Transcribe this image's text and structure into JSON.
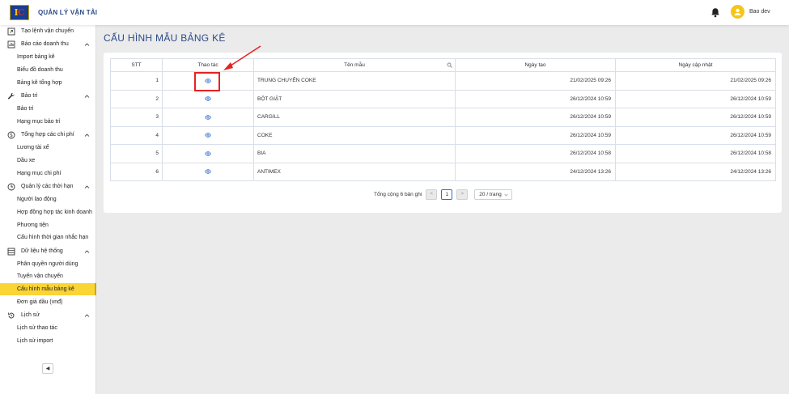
{
  "header": {
    "app_title": "QUẢN LÝ VẬN TẢI",
    "logo_text_left": "I",
    "logo_text_right": "C",
    "user_name": "Bao dev",
    "icons": {
      "notifications": "bell-icon",
      "avatar": "user-icon"
    }
  },
  "sidebar": {
    "groups": [
      {
        "label": "Tạo lệnh vận chuyển",
        "icon": "external-link-icon",
        "has_chevron": false
      },
      {
        "label": "Báo cáo doanh thu",
        "icon": "chart-icon",
        "items": [
          "Import bảng kê",
          "Biểu đồ doanh thu",
          "Bảng kê tổng hợp"
        ]
      },
      {
        "label": "Bảo trì",
        "icon": "wrench-icon",
        "items": [
          "Bảo trì",
          "Hạng mục bảo trì"
        ]
      },
      {
        "label": "Tổng hợp các chi phí",
        "icon": "dollar-icon",
        "items": [
          "Lương tài xế",
          "Dầu xe",
          "Hạng mục chi phí"
        ]
      },
      {
        "label": "Quản lý các thời hạn",
        "icon": "clock-icon",
        "items": [
          "Người lao động",
          "Hợp đồng hợp tác kinh doanh",
          "Phương tiện",
          "Cấu hình thời gian nhắc hạn"
        ]
      },
      {
        "label": "Dữ liệu hệ thống",
        "icon": "database-icon",
        "items": [
          "Phân quyền người dùng",
          "Tuyến vận chuyển",
          "Cấu hình mẫu bảng kê",
          "Đơn giá dầu (vnđ)"
        ]
      },
      {
        "label": "Lịch sử",
        "icon": "history-icon",
        "items": [
          "Lịch sử thao tác",
          "Lịch sử import"
        ]
      }
    ],
    "active_item": "Cấu hình mẫu bảng kê",
    "active_color": "#fbd435",
    "collapse_icon": "caret-left-icon",
    "collapse_label": "◀"
  },
  "main": {
    "page_title": "CẤU HÌNH MẪU BẢNG KÊ",
    "table": {
      "columns": [
        "STT",
        "Thao tác",
        "Tên mẫu",
        "Ngày tạo",
        "Ngày cập nhật"
      ],
      "rows": [
        {
          "stt": "1",
          "name": "TRUNG CHUYỂN COKE",
          "created": "21/02/2025 09:26",
          "updated": "21/02/2025 09:26"
        },
        {
          "stt": "2",
          "name": "BỘT GIẶT",
          "created": "26/12/2024 10:59",
          "updated": "26/12/2024 10:59"
        },
        {
          "stt": "3",
          "name": "CARGILL",
          "created": "26/12/2024 10:59",
          "updated": "26/12/2024 10:59"
        },
        {
          "stt": "4",
          "name": "COKE",
          "created": "26/12/2024 10:59",
          "updated": "26/12/2024 10:59"
        },
        {
          "stt": "5",
          "name": "BIA",
          "created": "26/12/2024 10:58",
          "updated": "26/12/2024 10:58"
        },
        {
          "stt": "6",
          "name": "ANTIMEX",
          "created": "24/12/2024 13:26",
          "updated": "24/12/2024 13:26"
        }
      ],
      "action_icon": "eye-icon",
      "search_icon": "search-icon"
    },
    "pagination": {
      "total_text": "Tổng cộng 6 bản ghi",
      "prev_label": "<",
      "next_label": ">",
      "current_page": "1",
      "page_size": "20 / trang"
    },
    "annotation": {
      "highlight_color": "#e52222"
    }
  }
}
